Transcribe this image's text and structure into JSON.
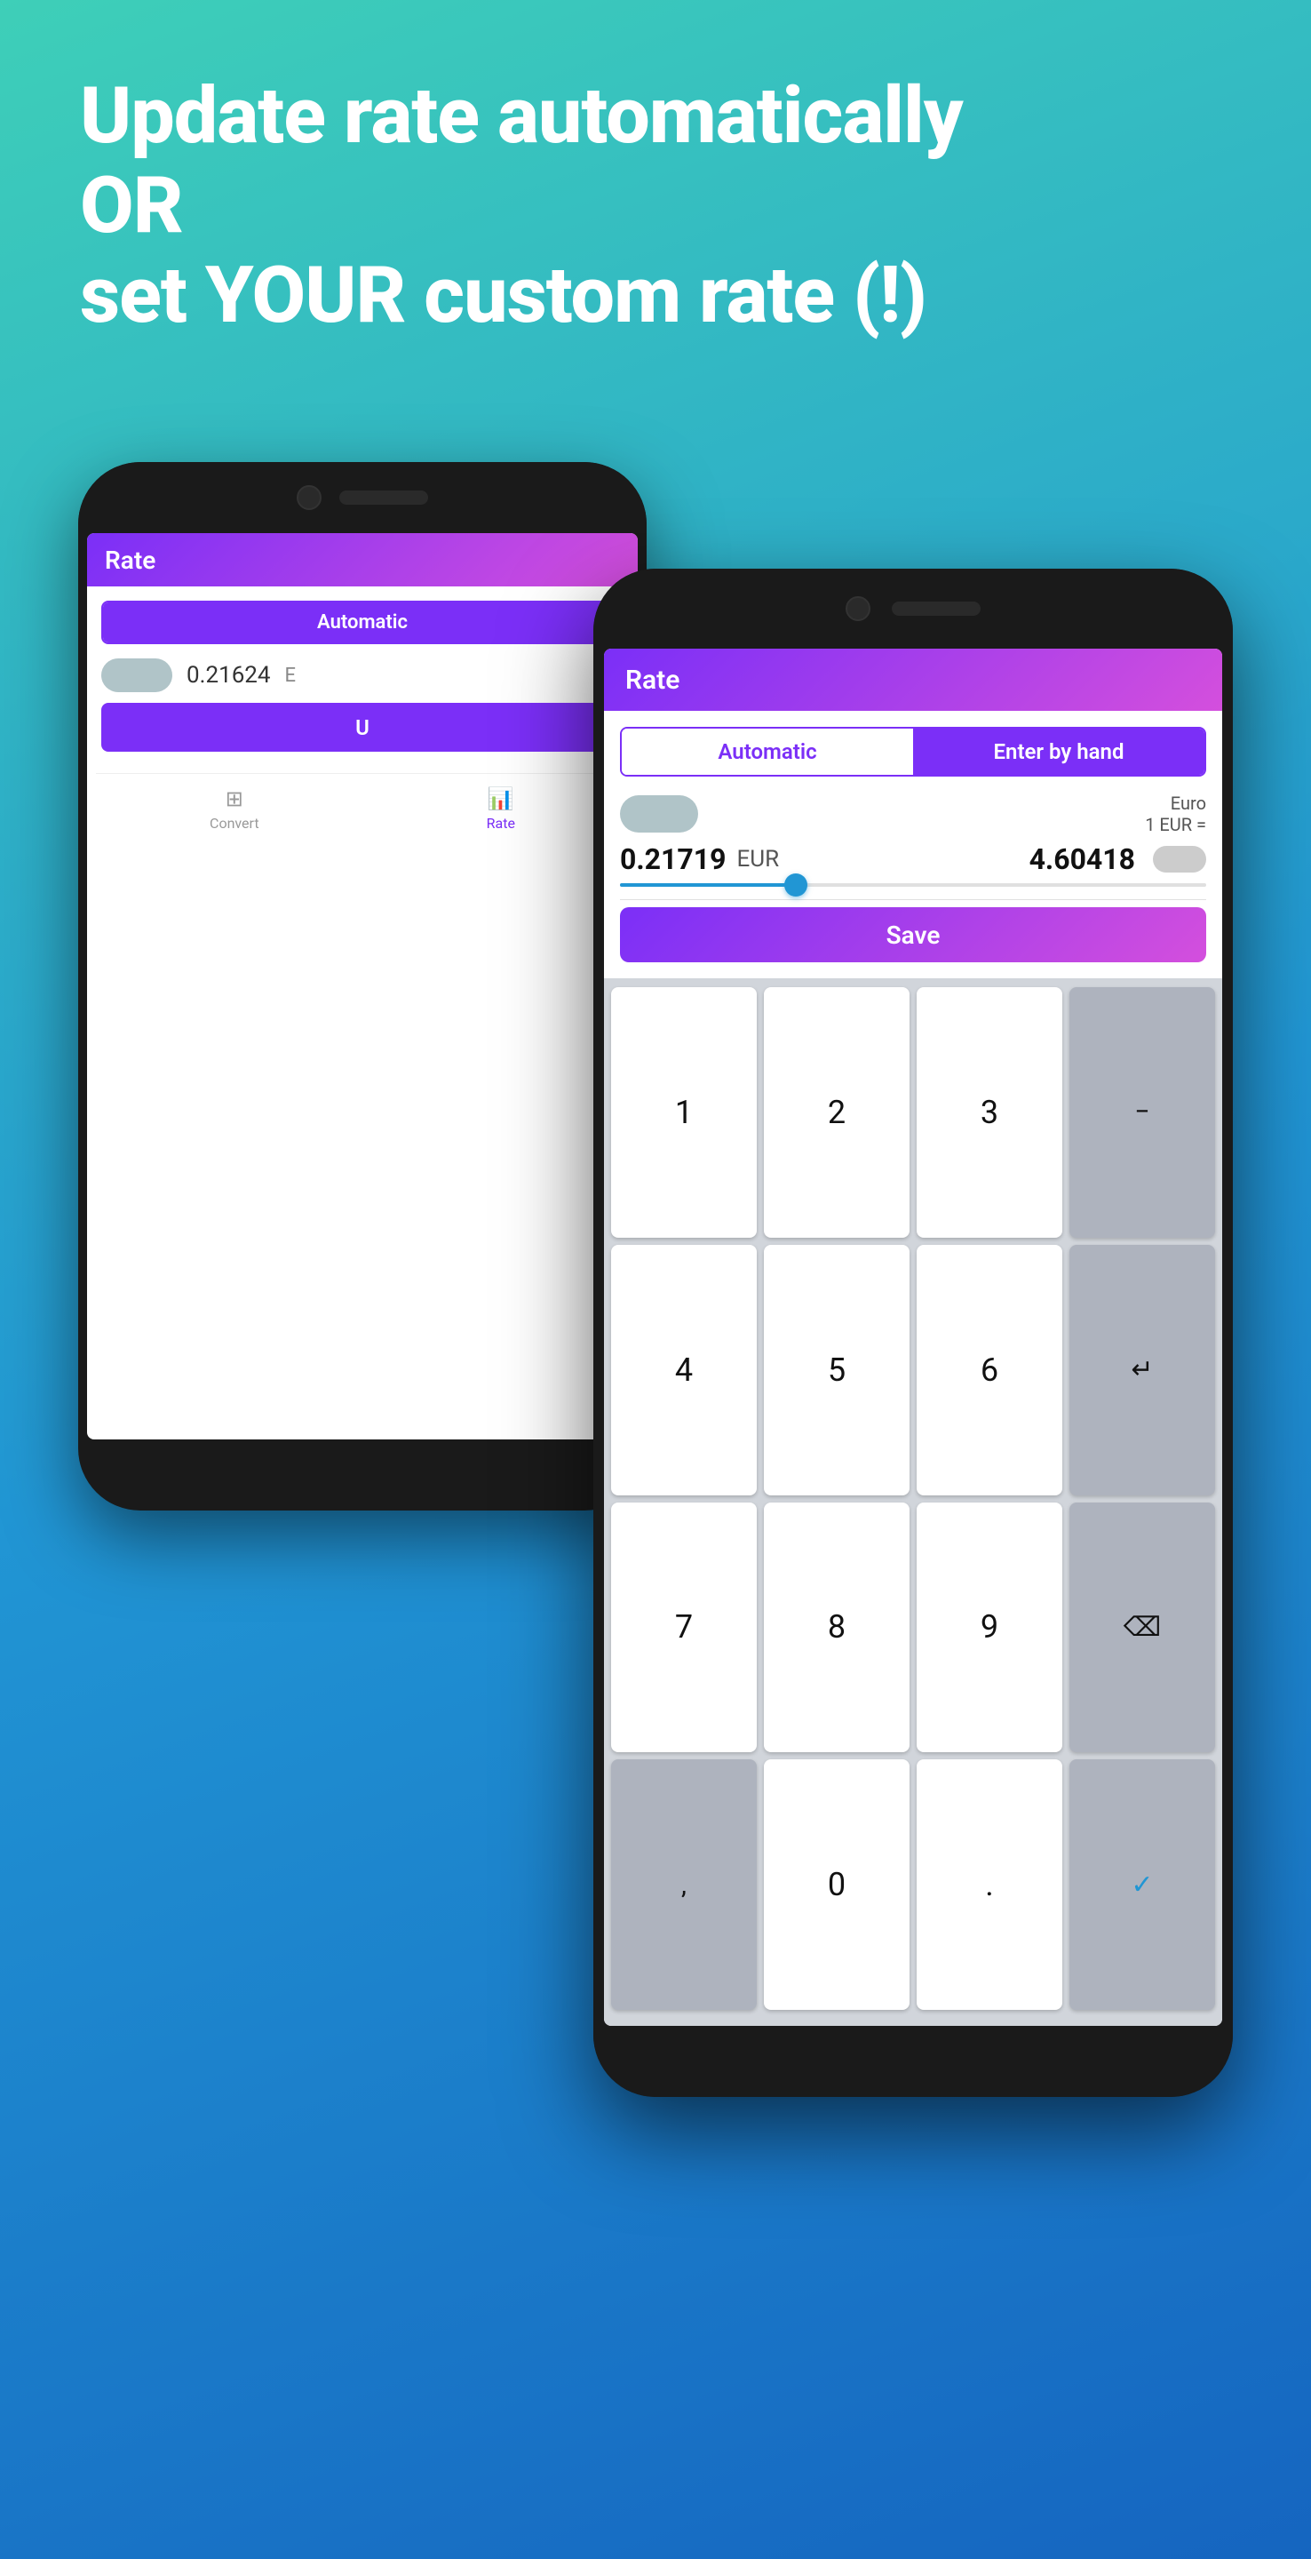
{
  "headline": {
    "line1": "Update rate automatically",
    "line2": "OR",
    "line3": "set YOUR custom rate (!)"
  },
  "back_phone": {
    "header_title": "Rate",
    "tab_automatic": "Automatic",
    "rate_value": "0.21624",
    "rate_unit": "E",
    "save_btn": "U"
  },
  "front_phone": {
    "header_title": "Rate",
    "tab_automatic": "Automatic",
    "tab_enter_by_hand": "Enter by hand",
    "euro_label": "Euro",
    "eur_equals": "1 EUR =",
    "rate_value": "0.21719",
    "rate_unit": "EUR",
    "rate_converted": "4.60418",
    "save_label": "Save"
  },
  "keyboard": {
    "rows": [
      [
        "1",
        "2",
        "3",
        "-"
      ],
      [
        "4",
        "5",
        "6",
        "↵"
      ],
      [
        "7",
        "8",
        "9",
        "⌫"
      ],
      [
        ",",
        "0",
        ".",
        "✓"
      ]
    ]
  },
  "nav": {
    "convert_label": "Convert",
    "rate_label": "Rate"
  },
  "colors": {
    "gradient_start": "#3ecfb8",
    "gradient_mid": "#2196d4",
    "gradient_end": "#1565c0",
    "purple": "#7b2ff7",
    "pink": "#d44fdd"
  }
}
